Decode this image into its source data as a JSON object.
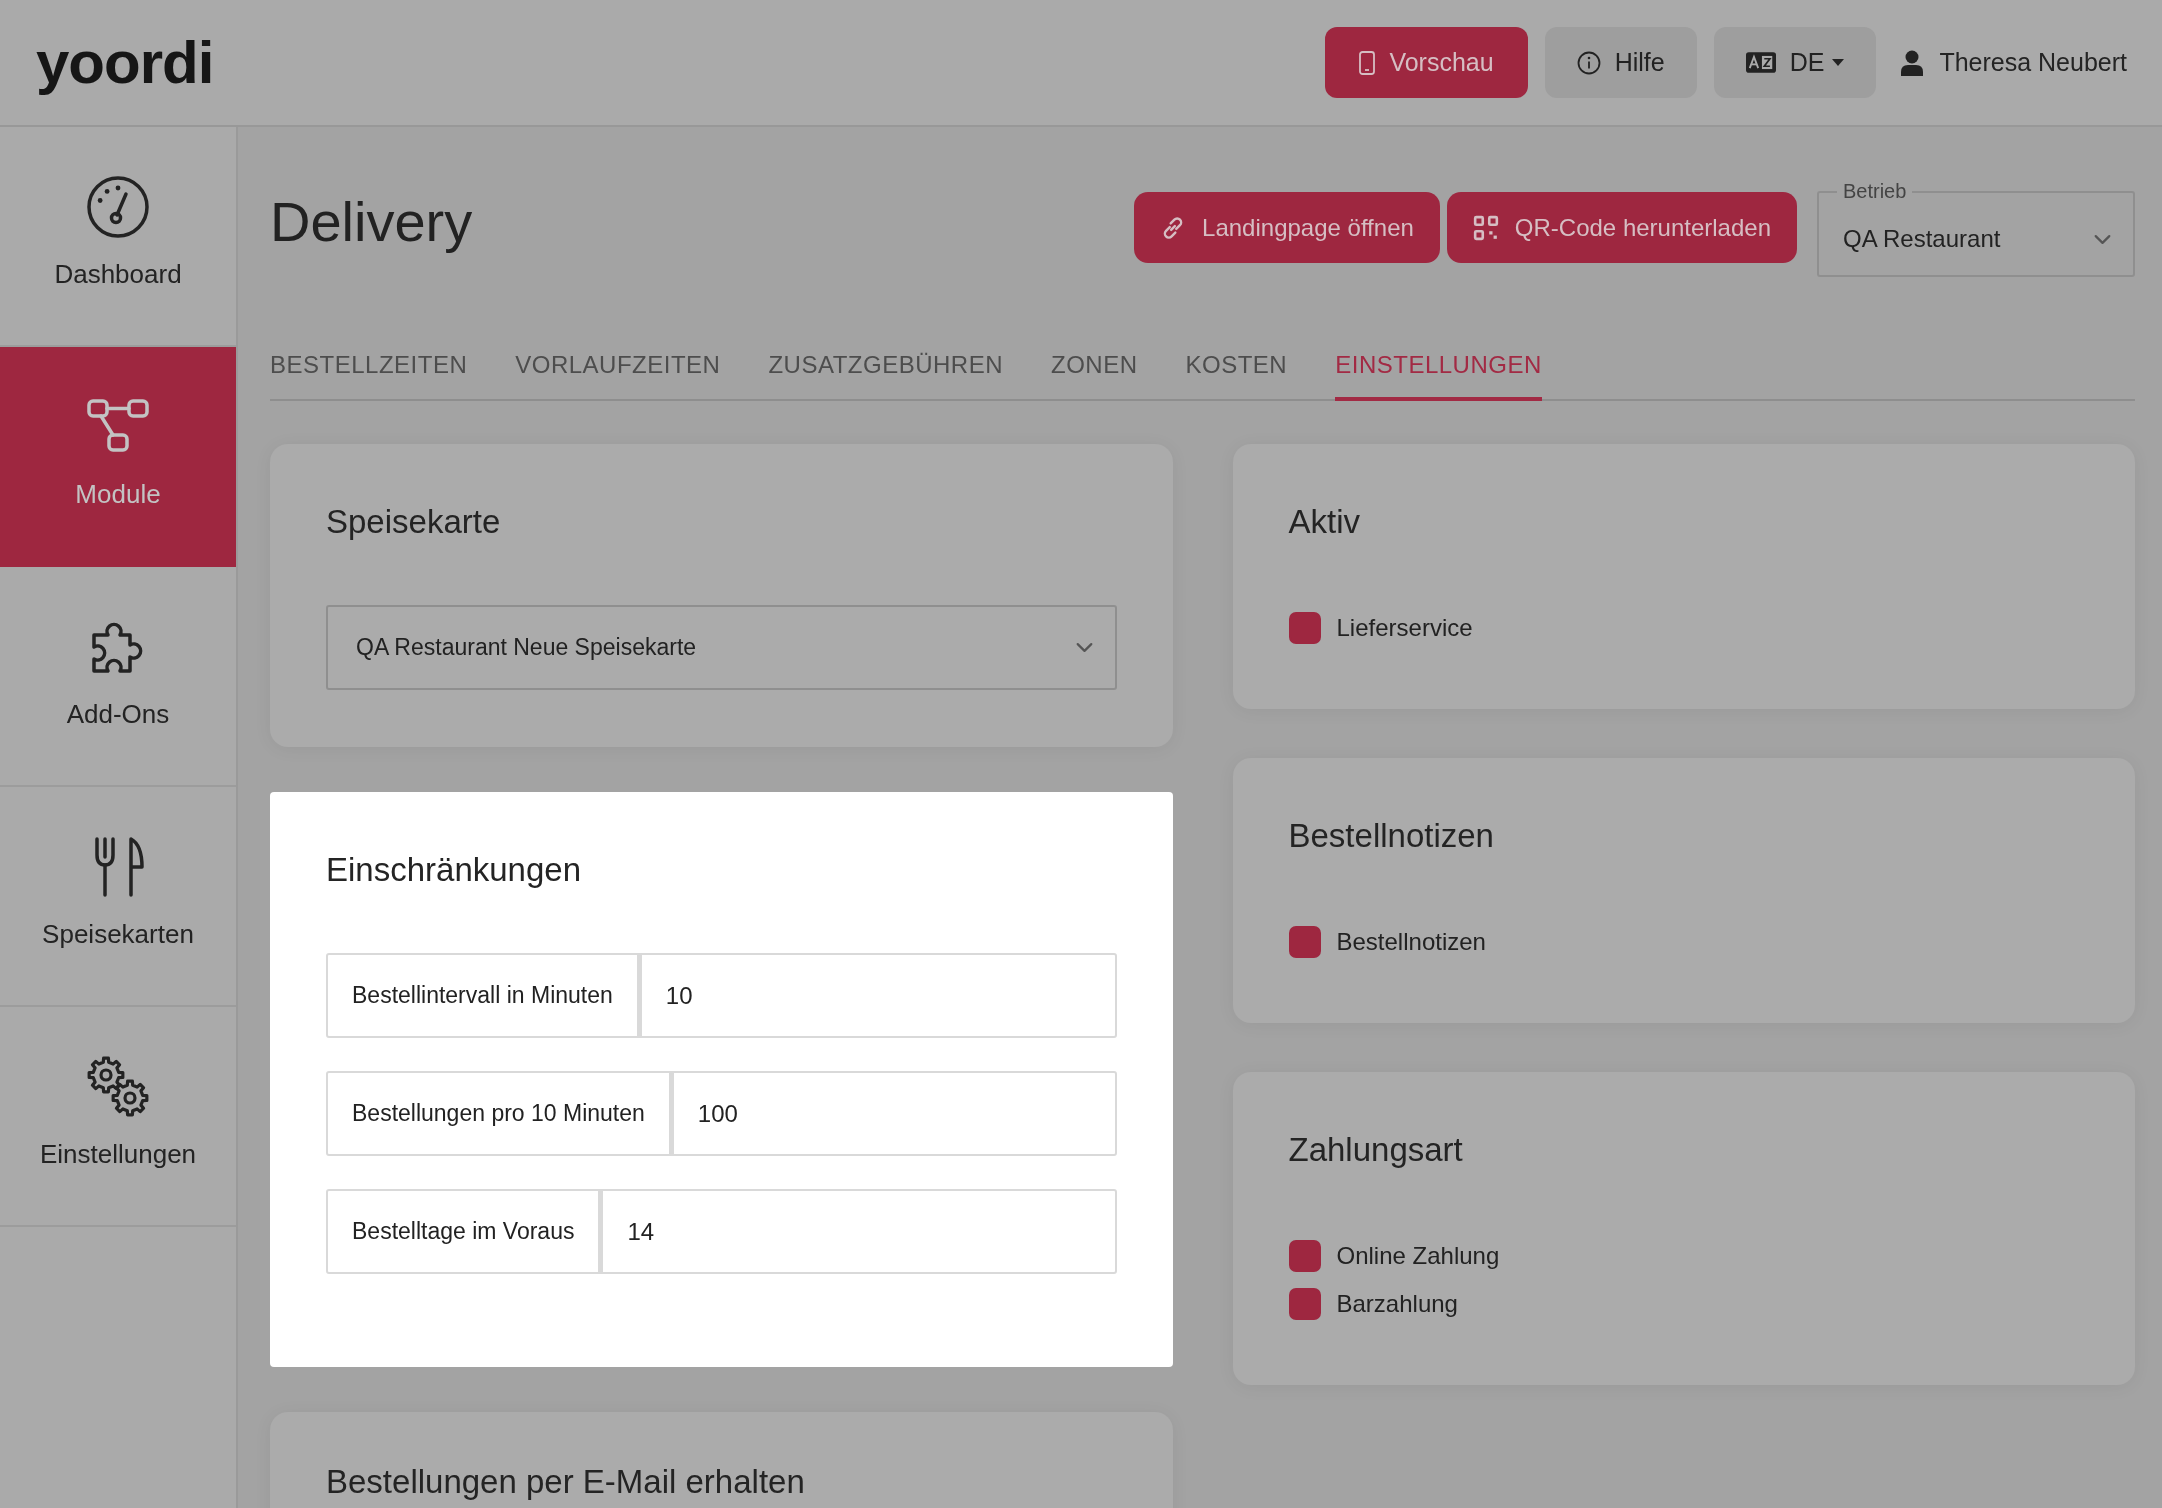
{
  "header": {
    "logo": "yoordi",
    "buttons": [
      {
        "kind": "preview",
        "label": "Vorschau"
      },
      {
        "kind": "help",
        "label": "Hilfe"
      },
      {
        "kind": "language",
        "label": "DE"
      }
    ],
    "user": {
      "name": "Theresa Neubert"
    }
  },
  "sidebar": {
    "items": [
      {
        "kind": "dashboard",
        "label": "Dashboard",
        "selected": false
      },
      {
        "kind": "module",
        "label": "Module",
        "selected": true
      },
      {
        "kind": "addons",
        "label": "Add-Ons",
        "selected": false
      },
      {
        "kind": "menus",
        "label": "Speisekarten",
        "selected": false
      },
      {
        "kind": "settings",
        "label": "Einstellungen",
        "selected": false
      }
    ]
  },
  "page": {
    "title": "Delivery",
    "actions": [
      {
        "kind": "link",
        "label": "Landingpage öffnen"
      },
      {
        "kind": "qr",
        "label": "QR-Code herunterladen"
      }
    ],
    "business_select": {
      "label": "Betrieb",
      "value": "QA Restaurant"
    }
  },
  "tabs": [
    {
      "label": "BESTELLZEITEN",
      "selected": false
    },
    {
      "label": "VORLAUFZEITEN",
      "selected": false
    },
    {
      "label": "ZUSATZGEBÜHREN",
      "selected": false
    },
    {
      "label": "ZONEN",
      "selected": false
    },
    {
      "label": "KOSTEN",
      "selected": false
    },
    {
      "label": "EINSTELLUNGEN",
      "selected": true
    }
  ],
  "left_cards": [
    {
      "kind": "select",
      "title": "Speisekarte",
      "highlighted": false,
      "value": "QA Restaurant Neue Speisekarte"
    },
    {
      "kind": "inputs",
      "title": "Einschränkungen",
      "highlighted": true,
      "fields": [
        {
          "label": "Bestellintervall in Minuten",
          "value": "10"
        },
        {
          "label": "Bestellungen pro 10 Minuten",
          "value": "100"
        },
        {
          "label": "Bestelltage im Voraus",
          "value": "14"
        }
      ]
    },
    {
      "kind": "heading",
      "title": "Bestellungen per E-Mail erhalten",
      "highlighted": false
    }
  ],
  "right_cards": [
    {
      "kind": "checkboxes",
      "title": "Aktiv",
      "highlighted": false,
      "options": [
        {
          "label": "Lieferservice",
          "checked": true
        }
      ]
    },
    {
      "kind": "checkboxes",
      "title": "Bestellnotizen",
      "highlighted": false,
      "options": [
        {
          "label": "Bestellnotizen",
          "checked": true
        }
      ]
    },
    {
      "kind": "checkboxes",
      "title": "Zahlungsart",
      "highlighted": false,
      "options": [
        {
          "label": "Online Zahlung",
          "checked": true
        },
        {
          "label": "Barzahlung",
          "checked": true
        }
      ]
    }
  ]
}
